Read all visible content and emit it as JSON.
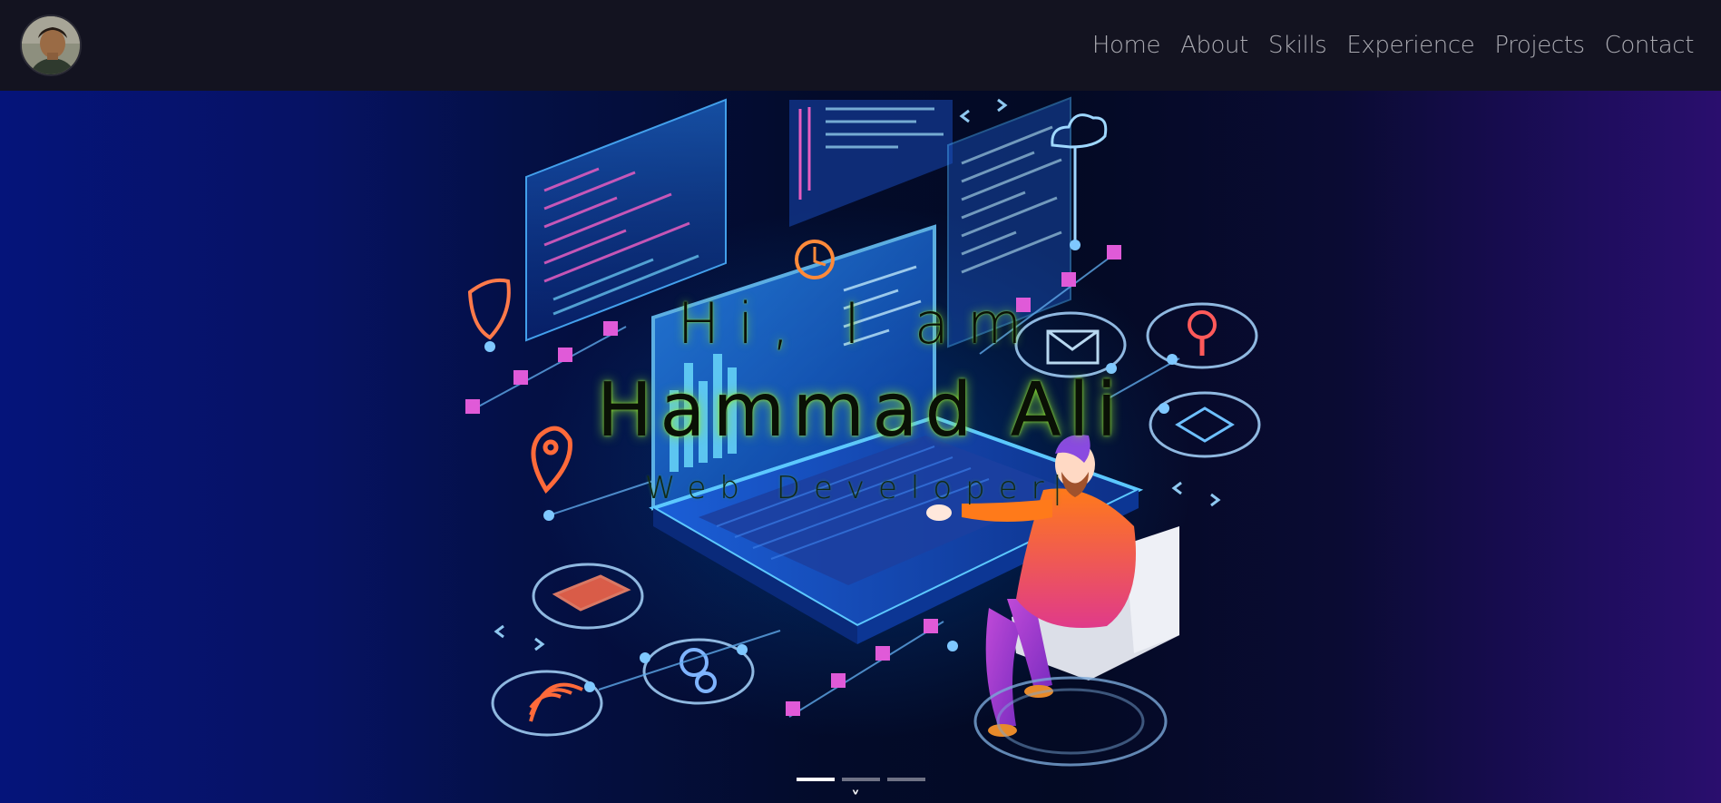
{
  "navbar": {
    "avatar_alt": "profile photo",
    "links": [
      {
        "label": "Home"
      },
      {
        "label": "About"
      },
      {
        "label": "Skills"
      },
      {
        "label": "Experience"
      },
      {
        "label": "Projects"
      },
      {
        "label": "Contact"
      }
    ]
  },
  "hero": {
    "greeting": "Hi, I am",
    "name": "Hammad Ali",
    "role": "Web Developer",
    "cursor": "|",
    "scroll_icon": "chevron-down-icon",
    "scroll_glyph": "˅",
    "carousel": {
      "slide_count": 3,
      "active_index": 0
    }
  },
  "colors": {
    "navbar_bg": "#131320",
    "nav_text": "#a9a9b0",
    "hero_left": "#05147a",
    "hero_right": "#2a0e6e",
    "text_glow": "#8ce628"
  }
}
